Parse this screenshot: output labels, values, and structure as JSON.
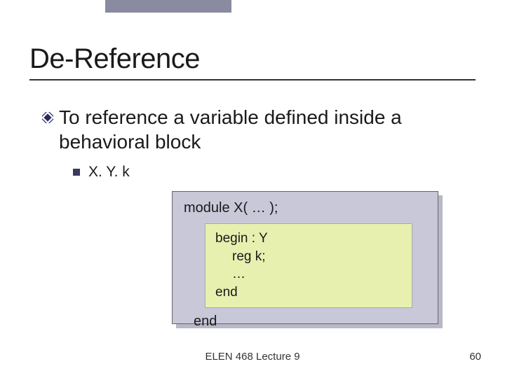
{
  "title": "De-Reference",
  "bullet": "To reference a variable defined inside a behavioral block",
  "sub_bullet": "X. Y. k",
  "code": {
    "module_line": "module X( … );",
    "inner": {
      "begin": "begin : Y",
      "reg": "reg k;",
      "dots": "…",
      "end": "end"
    },
    "end_outer": "end"
  },
  "footer": {
    "center": "ELEN 468 Lecture 9",
    "page": "60"
  }
}
